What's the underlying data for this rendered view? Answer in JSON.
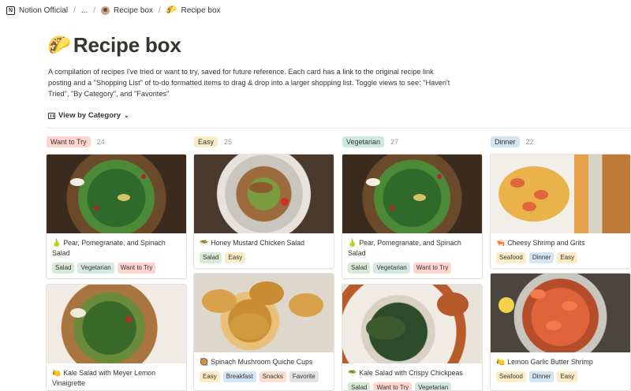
{
  "breadcrumb": {
    "workspace": "Notion Official",
    "ellipsis": "...",
    "parent": "Recipe box",
    "current": "Recipe box"
  },
  "page": {
    "icon": "taco-icon",
    "title": "Recipe box",
    "description": "A compilation of recipes I've tried or want to try, saved for future reference. Each card has a link to the original recipe link posting and a \"Shopping List\" of to-do formatted items to drag & drop into a larger shopping list. Toggle views to see: \"Haven't Tried\", \"By Category\", and \"Favorites\""
  },
  "view": {
    "label": "View by Category"
  },
  "colors": {
    "want_to_try": "#ffd5d0",
    "easy": "#fbecc6",
    "vegetarian": "#cde8e0",
    "dinner": "#d3e5f2"
  },
  "columns": [
    {
      "name": "Want to Try",
      "count": "24",
      "cards": [
        {
          "title": "Pear, Pomegranate, and Spinach Salad",
          "icon": "pear-icon",
          "tags": [
            "Salad",
            "Vegetarian",
            "Want to Try"
          ]
        },
        {
          "title": "Kale Salad with Meyer Lemon Vinaigrette",
          "icon": "lemon-icon",
          "tags": []
        }
      ]
    },
    {
      "name": "Easy",
      "count": "25",
      "cards": [
        {
          "title": "Honey Mustard Chicken Salad",
          "icon": "salad-bowl-icon",
          "tags": [
            "Salad",
            "Easy"
          ]
        },
        {
          "title": "Spinach Mushroom Quiche Cups",
          "icon": "quiche-icon",
          "tags": [
            "Easy",
            "Breakfast",
            "Snacks",
            "Favorite"
          ]
        }
      ]
    },
    {
      "name": "Vegetarian",
      "count": "27",
      "cards": [
        {
          "title": "Pear, Pomegranate, and Spinach Salad",
          "icon": "pear-icon",
          "tags": [
            "Salad",
            "Vegetarian",
            "Want to Try"
          ]
        },
        {
          "title": "Kale Salad with Crispy Chickpeas",
          "icon": "salad-bowl-icon",
          "tags": [
            "Salad",
            "Want to Try",
            "Vegetarian"
          ]
        }
      ]
    },
    {
      "name": "Dinner",
      "count": "22",
      "cards": [
        {
          "title": "Cheesy Shrimp and Grits",
          "icon": "shrimp-icon",
          "tags": [
            "Seafood",
            "Dinner",
            "Easy"
          ]
        },
        {
          "title": "Lemon Garlic Butter Shrimp",
          "icon": "lemon-icon",
          "tags": [
            "Seafood",
            "Dinner",
            "Easy"
          ]
        }
      ]
    }
  ]
}
